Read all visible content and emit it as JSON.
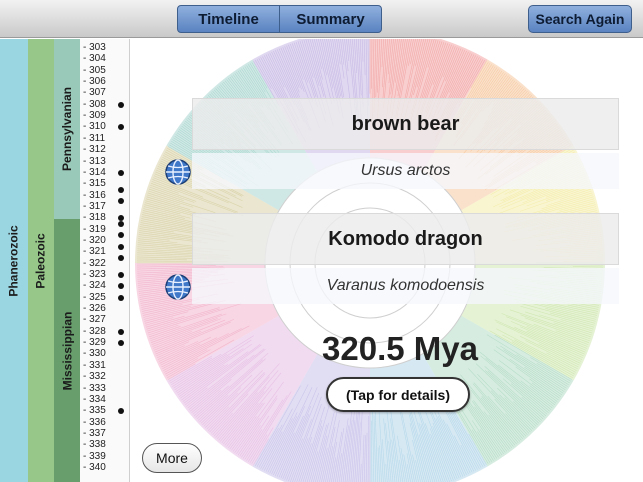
{
  "toolbar": {
    "timeline_label": "Timeline",
    "summary_label": "Summary",
    "search_again_label": "Search Again"
  },
  "timescale": {
    "eon": "Phanerozoic",
    "era": "Paleozoic",
    "periods": [
      "Pennsylvanian",
      "Mississippian"
    ],
    "ticks": [
      "- 303",
      "- 304",
      "- 305",
      "- 306",
      "- 307",
      "- 308",
      "- 309",
      "- 310",
      "- 311",
      "- 312",
      "- 313",
      "- 314",
      "- 315",
      "- 316",
      "- 317",
      "- 318",
      "- 319",
      "- 320",
      "- 321",
      "- 322",
      "- 323",
      "- 324",
      "- 325",
      "- 326",
      "- 327",
      "- 328",
      "- 329",
      "- 330",
      "- 331",
      "- 332",
      "- 333",
      "- 334",
      "- 335",
      "- 336",
      "- 337",
      "- 338",
      "- 339",
      "- 340"
    ],
    "event_marks_mya": [
      308,
      310,
      314,
      315.5,
      316.5,
      318,
      318.5,
      319.5,
      320.5,
      321.5,
      323,
      324,
      325,
      328,
      329,
      335
    ]
  },
  "taxa": {
    "first_common": "brown bear",
    "first_latin": "Ursus arctos",
    "second_common": "Komodo dragon",
    "second_latin": "Varanus komodoensis",
    "globe_icon": "globe-icon"
  },
  "divergence": {
    "time_label": "320.5 Mya",
    "details_label": "(Tap for details)"
  },
  "more_label": "More",
  "tree_colors": [
    "#f2a6a6",
    "#f6c9a0",
    "#f4ecaa",
    "#cfe7b0",
    "#b4dcc6",
    "#b4d7ea",
    "#c8c2ea",
    "#e6bde4",
    "#f2b4cc",
    "#d9d2a8",
    "#a9d6cf",
    "#c6b8e4"
  ]
}
